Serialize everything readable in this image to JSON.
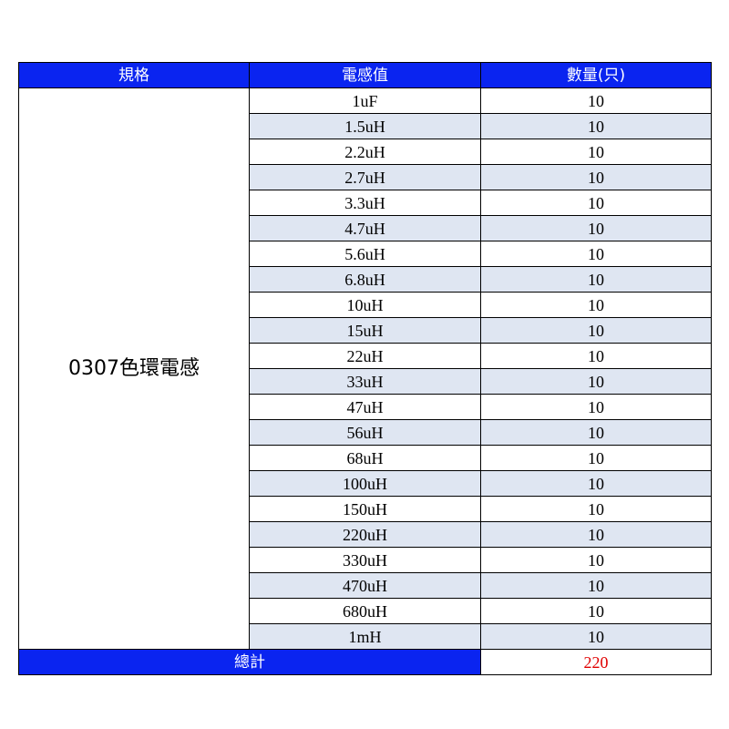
{
  "headers": {
    "spec": "規格",
    "inductance": "電感值",
    "quantity": "數量(只)"
  },
  "spec_name": "0307色環電感",
  "rows": [
    {
      "inductance": "1uF",
      "quantity": "10"
    },
    {
      "inductance": "1.5uH",
      "quantity": "10"
    },
    {
      "inductance": "2.2uH",
      "quantity": "10"
    },
    {
      "inductance": "2.7uH",
      "quantity": "10"
    },
    {
      "inductance": "3.3uH",
      "quantity": "10"
    },
    {
      "inductance": "4.7uH",
      "quantity": "10"
    },
    {
      "inductance": "5.6uH",
      "quantity": "10"
    },
    {
      "inductance": "6.8uH",
      "quantity": "10"
    },
    {
      "inductance": "10uH",
      "quantity": "10"
    },
    {
      "inductance": "15uH",
      "quantity": "10"
    },
    {
      "inductance": "22uH",
      "quantity": "10"
    },
    {
      "inductance": "33uH",
      "quantity": "10"
    },
    {
      "inductance": "47uH",
      "quantity": "10"
    },
    {
      "inductance": "56uH",
      "quantity": "10"
    },
    {
      "inductance": "68uH",
      "quantity": "10"
    },
    {
      "inductance": "100uH",
      "quantity": "10"
    },
    {
      "inductance": "150uH",
      "quantity": "10"
    },
    {
      "inductance": "220uH",
      "quantity": "10"
    },
    {
      "inductance": "330uH",
      "quantity": "10"
    },
    {
      "inductance": "470uH",
      "quantity": "10"
    },
    {
      "inductance": "680uH",
      "quantity": "10"
    },
    {
      "inductance": "1mH",
      "quantity": "10"
    }
  ],
  "total": {
    "label": "總計",
    "value": "220"
  },
  "colors": {
    "header": "#0a24f0",
    "alt_row": "#dfe6f2",
    "total_value": "#e00000"
  }
}
